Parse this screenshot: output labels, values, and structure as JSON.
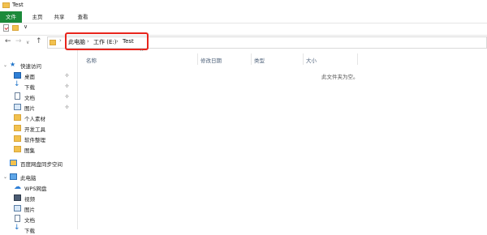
{
  "window": {
    "title": "Test"
  },
  "ribbon": {
    "tabs": [
      {
        "label": "文件",
        "active": true
      },
      {
        "label": "主页"
      },
      {
        "label": "共享"
      },
      {
        "label": "查看"
      }
    ]
  },
  "quick_access_toolbar": {
    "dropdown_glyph": "∨"
  },
  "navigation": {
    "back": "←",
    "forward": "→",
    "history": "∨",
    "up": "↑"
  },
  "address": {
    "separator": "›",
    "crumbs": [
      "此电脑",
      "工作 (E:)",
      "Test"
    ],
    "highlight_color": "#e8241c"
  },
  "navpane": {
    "quick_access": {
      "label": "快速访问",
      "icon": "star-icon"
    },
    "items": [
      {
        "label": "桌面",
        "icon": "desktop-icon",
        "pinned": true
      },
      {
        "label": "下载",
        "icon": "download-icon",
        "pinned": true
      },
      {
        "label": "文档",
        "icon": "document-icon",
        "pinned": true
      },
      {
        "label": "图片",
        "icon": "picture-icon",
        "pinned": true
      },
      {
        "label": "个人素材",
        "icon": "folder-icon"
      },
      {
        "label": "开发工具",
        "icon": "folder-icon"
      },
      {
        "label": "软件整理",
        "icon": "folder-icon"
      },
      {
        "label": "图集",
        "icon": "folder-icon"
      }
    ],
    "baidu": {
      "label": "百度网盘同步空间",
      "icon": "cloud-folder-icon"
    },
    "this_pc": {
      "label": "此电脑",
      "icon": "computer-icon"
    },
    "pc_items": [
      {
        "label": "WPS网盘",
        "icon": "cloud-icon"
      },
      {
        "label": "视频",
        "icon": "video-icon"
      },
      {
        "label": "图片",
        "icon": "picture-icon"
      },
      {
        "label": "文档",
        "icon": "document-icon"
      },
      {
        "label": "下载",
        "icon": "download-icon"
      }
    ],
    "pin_glyph": "📌"
  },
  "filelist": {
    "columns": [
      "名称",
      "修改日期",
      "类型",
      "大小"
    ],
    "sort_glyph": "^",
    "empty_message": "此文件夹为空。"
  },
  "colors": {
    "file_tab": "#1b8a3a",
    "folder": "#f2c14e",
    "accent_blue": "#1e73c9"
  }
}
